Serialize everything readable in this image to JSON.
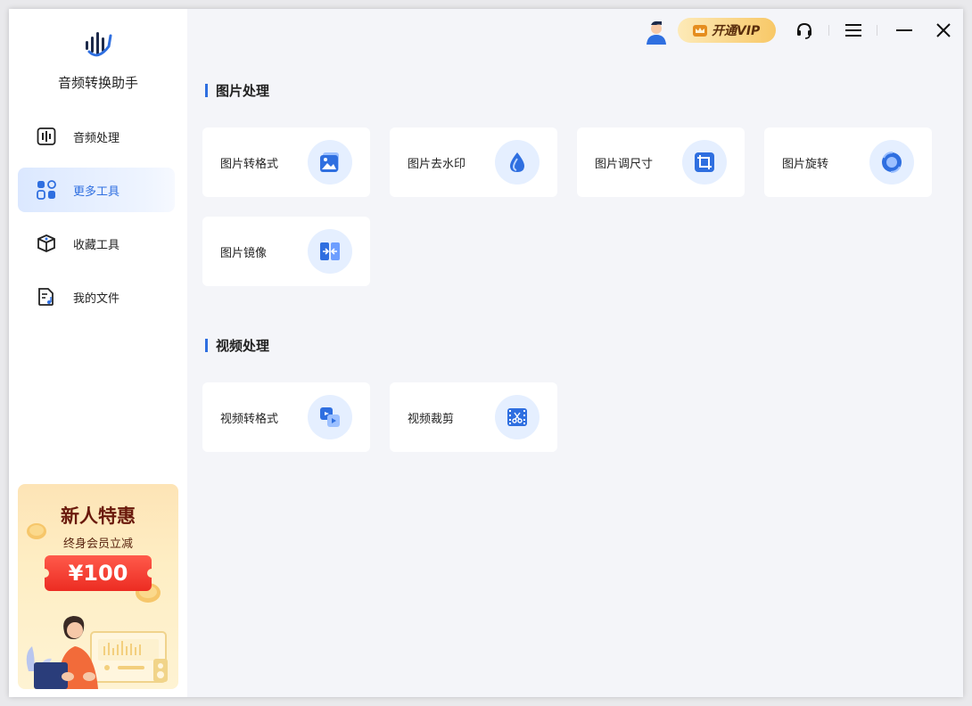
{
  "app": {
    "title": "音频转换助手"
  },
  "sidebar": {
    "items": [
      {
        "label": "音频处理",
        "icon": "audio-waveform-icon"
      },
      {
        "label": "更多工具",
        "icon": "grid-tools-icon",
        "active": true
      },
      {
        "label": "收藏工具",
        "icon": "box-collect-icon"
      },
      {
        "label": "我的文件",
        "icon": "file-music-icon"
      }
    ]
  },
  "promo": {
    "title": "新人特惠",
    "subtitle": "终身会员立减",
    "price": "¥100"
  },
  "topbar": {
    "vip_label": "开通VIP",
    "icons": [
      "user-avatar-icon",
      "crown-icon",
      "headset-icon",
      "menu-icon",
      "minimize-icon",
      "close-icon"
    ]
  },
  "sections": [
    {
      "title": "图片处理",
      "cards": [
        {
          "label": "图片转格式",
          "icon": "image-convert-icon"
        },
        {
          "label": "图片去水印",
          "icon": "watermark-drop-icon"
        },
        {
          "label": "图片调尺寸",
          "icon": "crop-resize-icon"
        },
        {
          "label": "图片旋转",
          "icon": "rotate-image-icon"
        },
        {
          "label": "图片镜像",
          "icon": "mirror-image-icon"
        }
      ]
    },
    {
      "title": "视频处理",
      "cards": [
        {
          "label": "视频转格式",
          "icon": "video-convert-icon"
        },
        {
          "label": "视频裁剪",
          "icon": "video-cut-icon"
        }
      ]
    }
  ],
  "colors": {
    "accent": "#2f6fe0",
    "promo_red": "#ec2c22",
    "vip_gold": "#f8c867"
  }
}
